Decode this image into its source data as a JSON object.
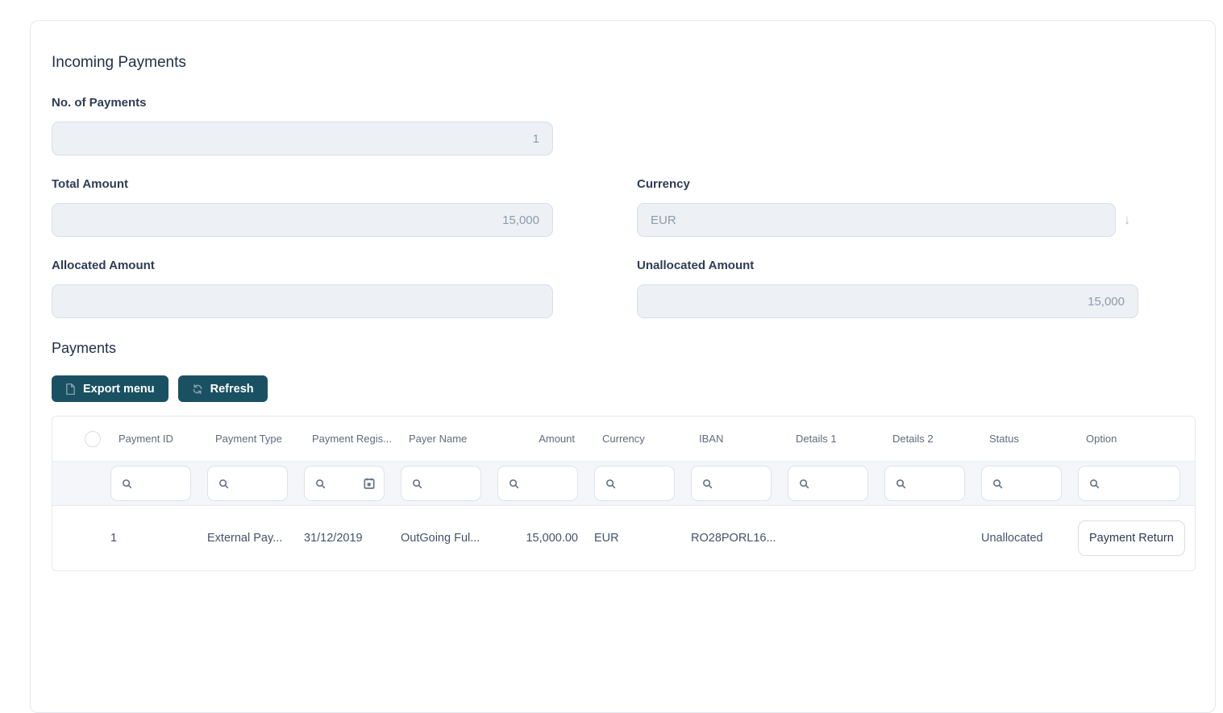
{
  "colors": {
    "accent_teal": "#1a5162",
    "card_border": "#e4e7ee",
    "input_bg": "#edf0f4",
    "input_border": "#d9dfe7",
    "muted_value_text": "#8f9aab",
    "label_text": "#2e3c55",
    "filter_row_bg": "#f4f6f9",
    "table_border": "#e6e9f0"
  },
  "header": {
    "title": "Incoming Payments"
  },
  "form": {
    "no_of_payments": {
      "label": "No. of Payments",
      "value": "1"
    },
    "total_amount": {
      "label": "Total Amount",
      "value": "15,000"
    },
    "currency": {
      "label": "Currency",
      "value": "EUR"
    },
    "allocated_amount": {
      "label": "Allocated Amount",
      "value": ""
    },
    "unallocated_amount": {
      "label": "Unallocated Amount",
      "value": "15,000"
    }
  },
  "icons": {
    "currency_dropdown_glyph": "↓",
    "export_icon": "file-icon",
    "refresh_icon": "refresh-icon",
    "filter_icon": "search-icon",
    "date_filter_icon": "calendar-icon"
  },
  "payments_section": {
    "title": "Payments",
    "toolbar": {
      "export_label": "Export menu",
      "refresh_label": "Refresh"
    }
  },
  "table": {
    "columns": [
      "Payment ID",
      "Payment Type",
      "Payment Regis...",
      "Payer Name",
      "Amount",
      "Currency",
      "IBAN",
      "Details 1",
      "Details 2",
      "Status",
      "Option"
    ],
    "rows": [
      {
        "payment_id": "1",
        "payment_type": "External Pay...",
        "payment_registration": "31/12/2019",
        "payer_name": "OutGoing Ful...",
        "amount": "15,000.00",
        "currency": "EUR",
        "iban": "RO28PORL16...",
        "details1": "",
        "details2": "",
        "status": "Unallocated",
        "option_label": "Payment Return"
      }
    ]
  }
}
